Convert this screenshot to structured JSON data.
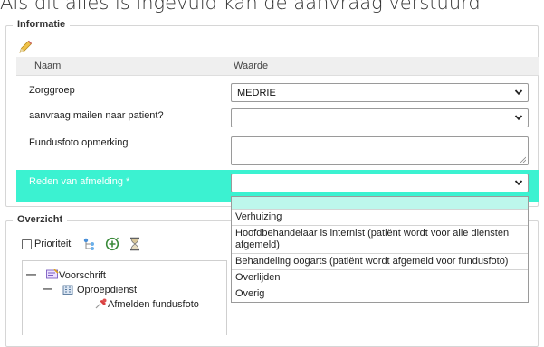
{
  "caption": "Als dit alles is ingevuld kan de aanvraag verstuurd",
  "informatie": {
    "legend": "Informatie",
    "edit_icon": "pencil-icon",
    "columns": {
      "name": "Naam",
      "value": "Waarde"
    },
    "rows": {
      "zorggroep": {
        "label": "Zorggroep",
        "value": "MEDRIE"
      },
      "mailen": {
        "label": "aanvraag mailen naar patient?",
        "value": ""
      },
      "fundusfoto": {
        "label": "Fundusfoto opmerking",
        "value": ""
      },
      "reden": {
        "label": "Reden van afmelding *",
        "value": ""
      }
    },
    "highlight_color": "#3bf2d1"
  },
  "dropdown": {
    "options": [
      "",
      "Verhuizing",
      "Hoofdbehandelaar is internist (patiënt wordt voor alle diensten afgemeld)",
      "Behandeling oogarts (patiënt wordt afgemeld voor fundusfoto)",
      "Overlijden",
      "Overig"
    ]
  },
  "overzicht": {
    "legend": "Overzicht",
    "prioriteit_label": "Prioriteit",
    "prioriteit_checked": false,
    "toolbar_icons": [
      "tree-structure-icon",
      "add-circle-icon",
      "hourglass-icon"
    ],
    "tree": {
      "voorschrift": "Voorschrift",
      "oproepdienst": "Oproepdienst",
      "afmelden": "Afmelden fundusfoto"
    }
  }
}
